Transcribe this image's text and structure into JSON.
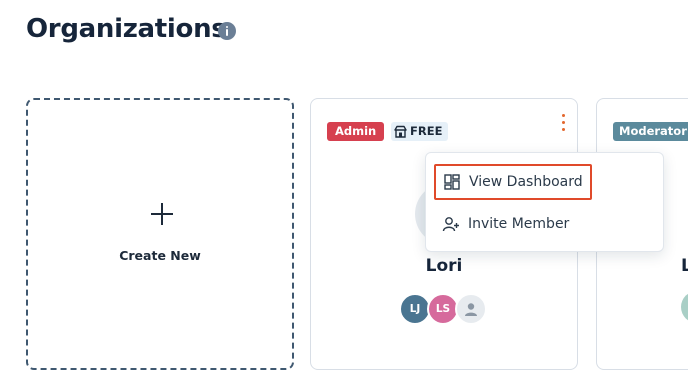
{
  "header": {
    "title": "Organizations",
    "info_icon": "info-icon"
  },
  "create_card": {
    "label": "Create New",
    "icon": "plus-icon"
  },
  "org_card": {
    "role_badge": "Admin",
    "plan_badge": "FREE",
    "plan_icon": "store-icon",
    "menu_icon": "kebab-menu-icon",
    "name": "Lori",
    "members": [
      {
        "initials": "LJ",
        "color": "#4a7591"
      },
      {
        "initials": "LS",
        "color": "#d66a9c"
      },
      {
        "initials": "",
        "icon": "user-icon",
        "color": "#e7ebef"
      }
    ]
  },
  "org_card_2": {
    "role_badge": "Moderator",
    "name_partial": "L"
  },
  "dropdown_menu": {
    "items": [
      {
        "label": "View Dashboard",
        "icon": "dashboard-icon"
      },
      {
        "label": "Invite Member",
        "icon": "invite-user-icon"
      }
    ]
  },
  "colors": {
    "admin_badge": "#d6404f",
    "moderator_badge": "#5b8a9c",
    "kebab_accent": "#e3672e",
    "highlight_border": "#e04a2a"
  }
}
